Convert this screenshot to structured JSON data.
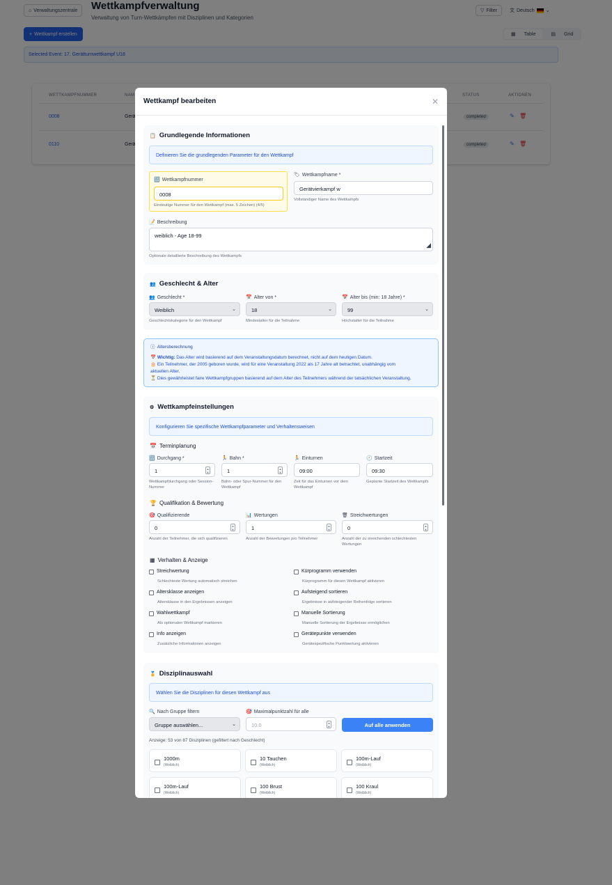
{
  "header": {
    "home_label": "Verwaltungszentrale",
    "title": "Wettkampfverwaltung",
    "subtitle": "Verwaltung von Turn-Wettkämpfen mit Disziplinen und Kategorien",
    "filter_label": "Filter",
    "language": "Deutsch",
    "create_label": "Wettkampf erstellen",
    "view_table": "Table",
    "view_grid": "Grid",
    "selected_event": "Selected Event: 17. Gerätturnwettkampf U18"
  },
  "table": {
    "columns": {
      "number": "WETTKAMPFNUMMER",
      "name": "NAM",
      "status": "STATUS",
      "actions": "AKTIONEN"
    },
    "rows": [
      {
        "number": "0008",
        "name": "Gerä",
        "status": "completed"
      },
      {
        "number": "0110",
        "name": "Gerä",
        "status": "completed"
      }
    ]
  },
  "modal": {
    "title": "Wettkampf bearbeiten",
    "basic": {
      "title": "Grundlegende Informationen",
      "info": "Definieren Sie die grundlegenden Parameter für den Wettkampf",
      "number_label": "Wettkampfnummer",
      "number_value": "0008",
      "number_help": "Eindeutige Nummer für den Wettkampf (max. 5 Zeichen) (4/5)",
      "name_label": "Wettkampfname *",
      "name_value": "Gerätvierkampf w",
      "name_help": "Vollständiger Name des Wettkampfs",
      "desc_label": "Beschreibung",
      "desc_value": "weiblich - Age 18-99",
      "desc_help": "Optionale detaillierte Beschreibung des Wettkampfs"
    },
    "gender_age": {
      "title": "Geschlecht & Alter",
      "gender_label": "Geschlecht *",
      "gender_value": "Weiblich",
      "gender_help": "Geschlechtskategorie für den Wettkampf",
      "age_from_label": "Alter von *",
      "age_from_value": "18",
      "age_from_help": "Mindestalter für die Teilnahme",
      "age_to_label": "Alter bis (min: 18 Jahre) *",
      "age_to_value": "99",
      "age_to_help": "Höchstalter für die Teilnahme"
    },
    "age_calc": {
      "title": "Altersberechnung",
      "important_bold": "Wichtig:",
      "important_text": "Das Alter wird basierend auf dem Veranstaltungsdatum berechnet, nicht auf dem heutigen Datum.",
      "example_1": "Ein Teilnehmer, der 2005 geboren wurde, wird für eine Veranstaltung 2022 als 17 Jahre alt betrachtet, unabhängig vom",
      "example_2": "aktuellen Alter.",
      "fair": "Dies gewährleistet faire Wettkampfgruppen basierend auf dem Alter des Teilnehmers während der tatsächlichen Veranstaltung."
    },
    "settings": {
      "title": "Wettkampfeinstellungen",
      "info": "Konfigurieren Sie spezifische Wettkampfparameter und Verhaltensweisen",
      "schedule_title": "Terminplanung",
      "round_label": "Durchgang *",
      "round_value": "1",
      "round_help_1": "Wettkampfdurchgang oder Session-",
      "round_help_2": "Nummer",
      "lane_label": "Bahn *",
      "lane_value": "1",
      "lane_help_1": "Bahn- oder Spur-Nummer für den",
      "lane_help_2": "Wettkampf",
      "warmup_label": "Einturnen",
      "warmup_value": "09:00",
      "warmup_help_1": "Zeit für das Einturnen vor dem",
      "warmup_help_2": "Wettkampf",
      "start_label": "Startzeit",
      "start_value": "09:30",
      "start_help": "Geplante Startzeit des Wettkampfs",
      "qual_title": "Qualifikation & Bewertung",
      "qualifiers_label": "Qualifizierende",
      "qualifiers_value": "0",
      "qualifiers_help": "Anzahl der Teilnehmer, die sich qualifizieren",
      "scores_label": "Wertungen",
      "scores_value": "1",
      "scores_help": "Anzahl der Bewertungen pro Teilnehmer",
      "drops_label": "Streichwertungen",
      "drops_value": "0",
      "drops_help_1": "Anzahl der zu streichenden schlechtesten",
      "drops_help_2": "Wertungen",
      "behavior_title": "Verhalten & Anzeige",
      "options": [
        {
          "label": "Streichwertung",
          "help": "Schlechteste Wertung automatisch streichen"
        },
        {
          "label": "Kürprogramm verwenden",
          "help": "Kürprogramm für diesen Wettkampf aktivieren"
        },
        {
          "label": "Altersklasse anzeigen",
          "help": "Altersklasse in den Ergebnissen anzeigen"
        },
        {
          "label": "Aufsteigend sortieren",
          "help": "Ergebnisse in aufsteigender Reihenfolge sortieren"
        },
        {
          "label": "Wahlwettkampf",
          "help": "Als optionalen Wettkampf markieren"
        },
        {
          "label": "Manuelle Sortierung",
          "help": "Manuelle Sortierung der Ergebnisse ermöglichen"
        },
        {
          "label": "Info anzeigen",
          "help": "Zusätzliche Informationen anzeigen"
        },
        {
          "label": "Gerätepunkte verwenden",
          "help": "Gerätespezifische Punktwertung aktivieren"
        }
      ]
    },
    "disciplines": {
      "title": "Disziplinauswahl",
      "info": "Wählen Sie die Disziplinen für diesen Wettkampf aus",
      "group_label": "Nach Gruppe filtern",
      "group_value": "Gruppe auswählen...",
      "max_label": "Maximalpunktzahl für alle",
      "max_placeholder": "10.0",
      "apply_label": "Auf alle anwenden",
      "count": "Anzeige: 53 von 87 Disziplinen (gefiltert nach Geschlecht)",
      "items": [
        {
          "name": "1000m",
          "gender": "(Weiblich)"
        },
        {
          "name": "10 Tauchen",
          "gender": "(Weiblich)"
        },
        {
          "name": "100m-Lauf",
          "gender": "(Weiblich)"
        },
        {
          "name": "100m-Lauf",
          "gender": "(Weiblich)"
        },
        {
          "name": "100 Brust",
          "gender": "(Weiblich)"
        },
        {
          "name": "100 Kraul",
          "gender": "(Weiblich)"
        }
      ]
    }
  }
}
